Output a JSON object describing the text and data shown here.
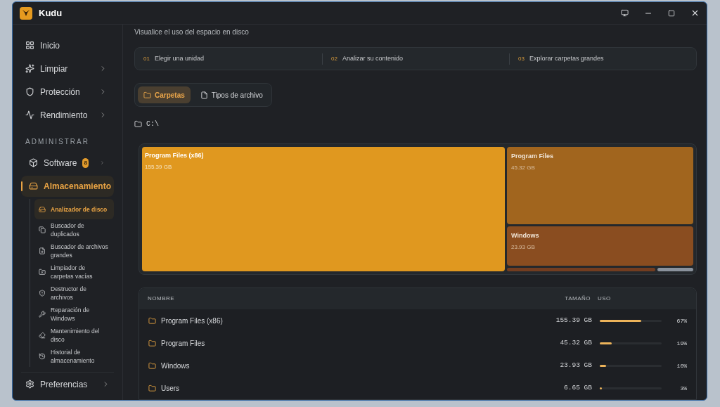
{
  "window": {
    "title": "Kudu"
  },
  "sidebar": {
    "items": [
      {
        "label": "Inicio",
        "selected": false
      },
      {
        "label": "Limpiar",
        "selected": false
      },
      {
        "label": "Protección",
        "selected": false
      },
      {
        "label": "Rendimiento",
        "selected": false
      }
    ],
    "section": "ADMINISTRAR",
    "manage_items": [
      {
        "label": "Software",
        "badge": "8",
        "expanded": false,
        "selected": false
      },
      {
        "label": "Almacenamiento",
        "expanded": true,
        "selected": true,
        "children": [
          {
            "label": "Analizador de disco",
            "selected": true
          },
          {
            "label": "Buscador de duplicados",
            "selected": false
          },
          {
            "label": "Buscador de archivos grandes",
            "selected": false
          },
          {
            "label": "Limpiador de carpetas vacías",
            "selected": false
          },
          {
            "label": "Destructor de archivos",
            "selected": false
          },
          {
            "label": "Reparación de Windows",
            "selected": false
          },
          {
            "label": "Mantenimiento del disco",
            "selected": false
          },
          {
            "label": "Historial de almacenamiento",
            "selected": false
          }
        ]
      }
    ],
    "footer": {
      "label": "Preferencias"
    }
  },
  "subtitle": "Visualice el uso del espacio en disco",
  "steps": [
    {
      "number": "01",
      "label": "Elegir una unidad"
    },
    {
      "number": "02",
      "label": "Analizar su contenido"
    },
    {
      "number": "03",
      "label": "Explorar carpetas grandes"
    }
  ],
  "tabs": [
    {
      "label": "Carpetas",
      "selected": true
    },
    {
      "label": "Tipos de archivo",
      "selected": false
    }
  ],
  "path": "C:\\",
  "treemap": {
    "main": {
      "name": "Program Files (x86)",
      "size": "155.39 GB",
      "color": "#e0981f"
    },
    "side": [
      {
        "name": "Program Files",
        "size": "45.32 GB",
        "color": "#a1651e"
      },
      {
        "name": "Windows",
        "size": "23.93 GB",
        "color": "#8a4d20"
      }
    ],
    "small": [
      {
        "color": "#733d20"
      },
      {
        "color": "#8a929c"
      }
    ]
  },
  "table": {
    "columns": [
      "NOMBRE",
      "TAMAÑO",
      "USO"
    ],
    "rows": [
      {
        "name": "Program Files (x86)",
        "size": "155.39 GB",
        "level": 0.67,
        "percent": "67%"
      },
      {
        "name": "Program Files",
        "size": "45.32 GB",
        "level": 0.19,
        "percent": "19%"
      },
      {
        "name": "Windows",
        "size": "23.93 GB",
        "level": 0.1,
        "percent": "10%"
      },
      {
        "name": "Users",
        "size": "6.65 GB",
        "level": 0.03,
        "percent": "3%"
      }
    ]
  }
}
